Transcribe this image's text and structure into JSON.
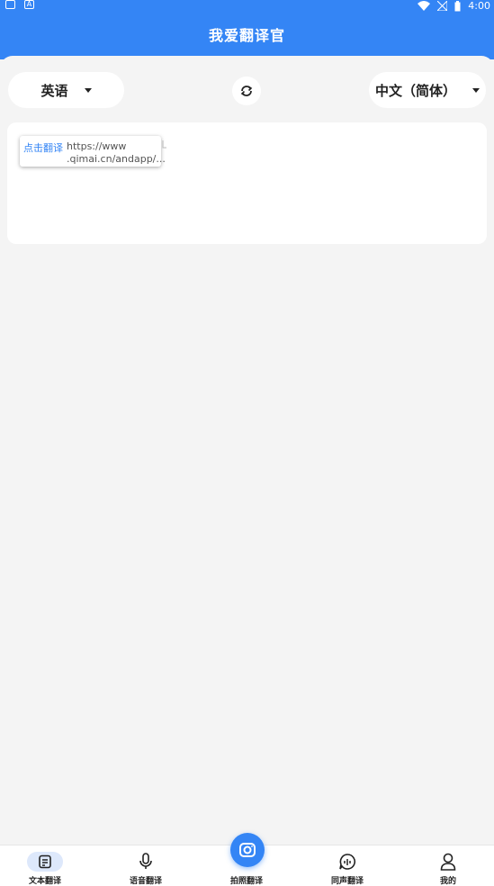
{
  "status_bar": {
    "time": "4:00",
    "left_icon_2": "A"
  },
  "app_bar": {
    "title": "我爱翻译官"
  },
  "language": {
    "source": "英语",
    "target": "中文（简体）"
  },
  "popup": {
    "button": "点击翻译",
    "url_line1": "https://www",
    "url_line2": ".qimai.cn/andapp/..."
  },
  "bottom_nav": {
    "items": [
      {
        "label": "文本翻译",
        "icon": "document-icon"
      },
      {
        "label": "语音翻译",
        "icon": "microphone-icon"
      },
      {
        "label": "拍照翻译",
        "icon": "camera-icon"
      },
      {
        "label": "同声翻译",
        "icon": "simultaneous-icon"
      },
      {
        "label": "我的",
        "icon": "user-icon"
      }
    ]
  },
  "colors": {
    "accent": "#3485f5",
    "background": "#f4f4f4"
  }
}
